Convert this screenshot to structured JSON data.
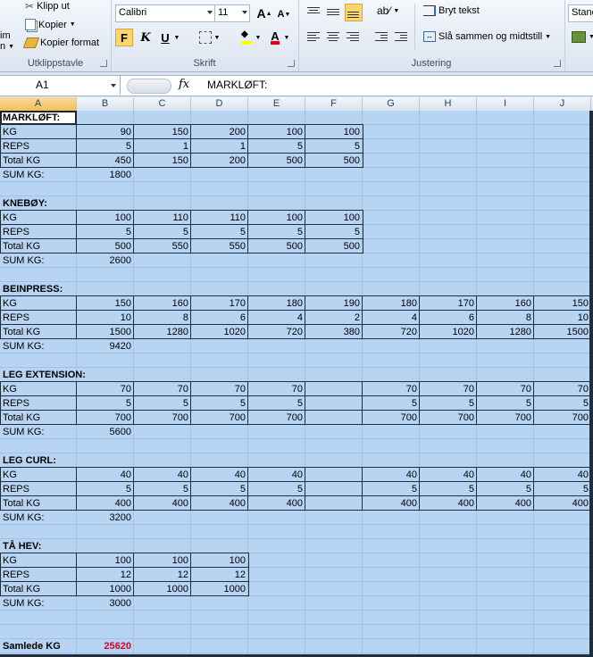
{
  "ribbon": {
    "clipboard": {
      "cut": "Klipp ut",
      "copy": "Kopier",
      "format_painter": "Kopier format",
      "paste_partial_1": "im",
      "paste_partial_2": "n",
      "label": "Utklippstavle"
    },
    "font": {
      "name": "Calibri",
      "size": "11",
      "label": "Skrift",
      "bold": "F",
      "italic": "K",
      "underline": "U",
      "grow": "A",
      "shrink": "A"
    },
    "alignment": {
      "wrap_text": "Bryt tekst",
      "merge_center": "Slå sammen og midtstill",
      "label": "Justering"
    },
    "number": {
      "format": "Stand"
    }
  },
  "formula_bar": {
    "name_box": "A1",
    "fx": "fx",
    "content": "MARKLØFT:"
  },
  "columns": [
    "A",
    "B",
    "C",
    "D",
    "E",
    "F",
    "G",
    "H",
    "I",
    "J"
  ],
  "sheet": {
    "blocks": [
      {
        "title": "MARKLØFT:",
        "rows": [
          {
            "label": "KG",
            "values": [
              "90",
              "150",
              "200",
              "100",
              "100"
            ]
          },
          {
            "label": "REPS",
            "values": [
              "5",
              "1",
              "1",
              "5",
              "5"
            ]
          },
          {
            "label": "Total KG",
            "values": [
              "450",
              "150",
              "200",
              "500",
              "500"
            ]
          }
        ],
        "sum_label": "SUM KG:",
        "sum": "1800"
      },
      {
        "title": "KNEBØY:",
        "rows": [
          {
            "label": "KG",
            "values": [
              "100",
              "110",
              "110",
              "100",
              "100"
            ]
          },
          {
            "label": "REPS",
            "values": [
              "5",
              "5",
              "5",
              "5",
              "5"
            ]
          },
          {
            "label": "Total KG",
            "values": [
              "500",
              "550",
              "550",
              "500",
              "500"
            ]
          }
        ],
        "sum_label": "SUM KG:",
        "sum": "2600"
      },
      {
        "title": "BEINPRESS:",
        "rows": [
          {
            "label": "KG",
            "values": [
              "150",
              "160",
              "170",
              "180",
              "190",
              "180",
              "170",
              "160",
              "150"
            ]
          },
          {
            "label": "REPS",
            "values": [
              "10",
              "8",
              "6",
              "4",
              "2",
              "4",
              "6",
              "8",
              "10"
            ]
          },
          {
            "label": "Total KG",
            "values": [
              "1500",
              "1280",
              "1020",
              "720",
              "380",
              "720",
              "1020",
              "1280",
              "1500"
            ]
          }
        ],
        "sum_label": "SUM KG:",
        "sum": "9420"
      },
      {
        "title": "LEG EXTENSION:",
        "rows": [
          {
            "label": "KG",
            "values": [
              "70",
              "70",
              "70",
              "70",
              "",
              "70",
              "70",
              "70",
              "70"
            ]
          },
          {
            "label": "REPS",
            "values": [
              "5",
              "5",
              "5",
              "5",
              "",
              "5",
              "5",
              "5",
              "5"
            ]
          },
          {
            "label": "Total KG",
            "values": [
              "700",
              "700",
              "700",
              "700",
              "",
              "700",
              "700",
              "700",
              "700"
            ]
          }
        ],
        "sum_label": "SUM KG:",
        "sum": "5600"
      },
      {
        "title": "LEG CURL:",
        "rows": [
          {
            "label": "KG",
            "values": [
              "40",
              "40",
              "40",
              "40",
              "",
              "40",
              "40",
              "40",
              "40"
            ]
          },
          {
            "label": "REPS",
            "values": [
              "5",
              "5",
              "5",
              "5",
              "",
              "5",
              "5",
              "5",
              "5"
            ]
          },
          {
            "label": "Total KG",
            "values": [
              "400",
              "400",
              "400",
              "400",
              "",
              "400",
              "400",
              "400",
              "400"
            ]
          }
        ],
        "sum_label": "SUM KG:",
        "sum": "3200"
      },
      {
        "title": "TÅ HEV:",
        "rows": [
          {
            "label": "KG",
            "values": [
              "100",
              "100",
              "100"
            ]
          },
          {
            "label": "REPS",
            "values": [
              "12",
              "12",
              "12"
            ]
          },
          {
            "label": "Total KG",
            "values": [
              "1000",
              "1000",
              "1000"
            ]
          }
        ],
        "sum_label": "SUM KG:",
        "sum": "3000"
      }
    ],
    "grand_total_label": "Samlede KG",
    "grand_total": "25620"
  },
  "colors": {
    "selection": "#b8d4f3",
    "grand_total": "#e0001b",
    "active_button": "#fbd56e"
  }
}
